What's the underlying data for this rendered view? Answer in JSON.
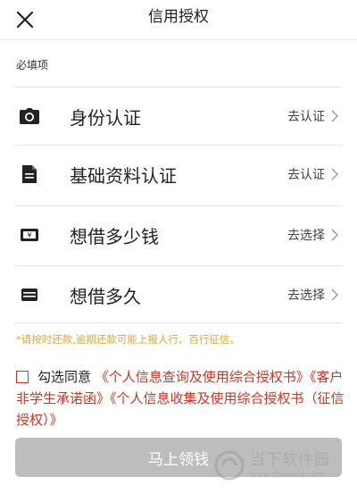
{
  "header": {
    "title": "信用授权"
  },
  "section": {
    "label": "必填项"
  },
  "items": [
    {
      "label": "身份认证",
      "action": "去认证",
      "icon": "camera-icon"
    },
    {
      "label": "基础资料认证",
      "action": "去认证",
      "icon": "document-icon"
    },
    {
      "label": "想借多少钱",
      "action": "去选择",
      "icon": "yuan-banknote-icon"
    },
    {
      "label": "想借多久",
      "action": "去选择",
      "icon": "calendar-card-icon"
    }
  ],
  "notice": "*请按时还款,逾期还款可能上报人行、百行征信。",
  "agreement": {
    "prefix": "勾选同意",
    "link1": "《个人信息查询及使用综合授权书》",
    "link2": "《客户非学生承诺函》",
    "link3": "《个人信息收集及使用综合授权书（征信授权）》"
  },
  "cta": {
    "label": "马上领钱"
  },
  "watermark": {
    "name": "当下软件园",
    "url": "www.downxia.com"
  },
  "colors": {
    "accent": "#c0392b",
    "notice": "#d6a93a",
    "button_disabled": "#bdbdbd"
  }
}
